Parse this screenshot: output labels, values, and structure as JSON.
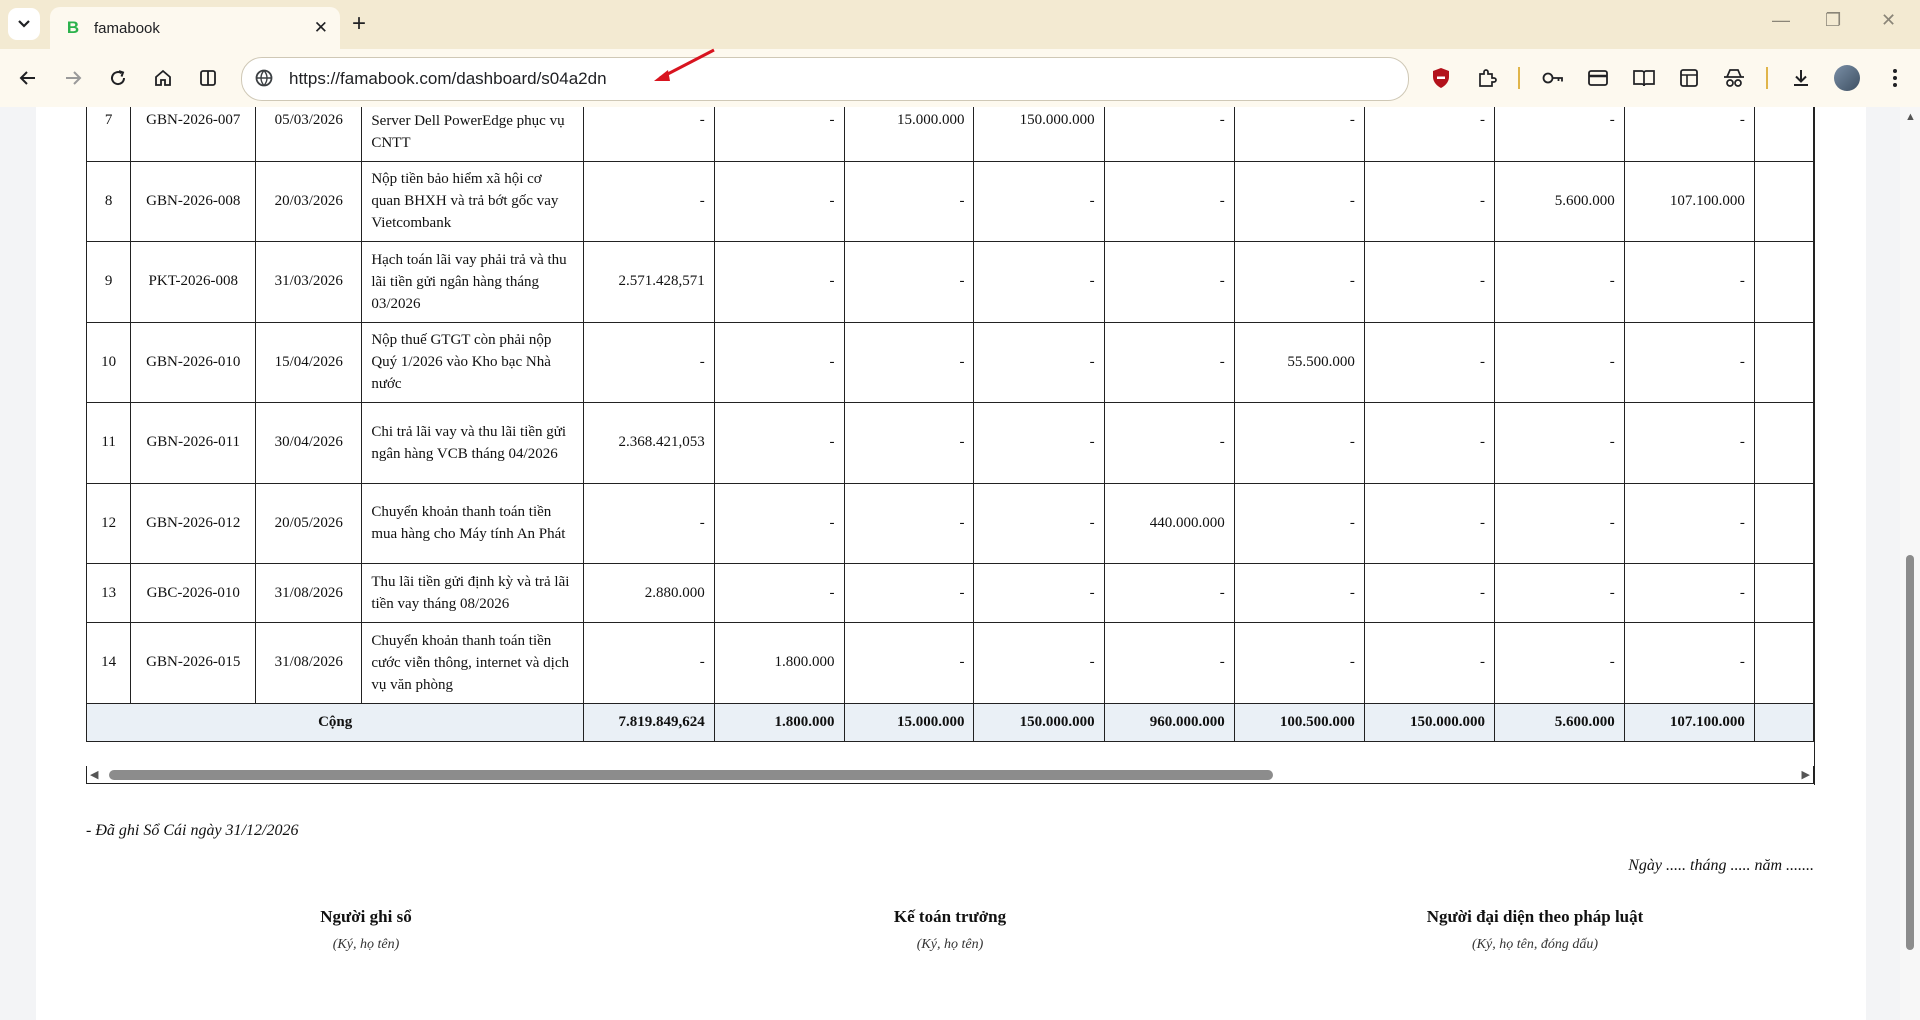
{
  "browser": {
    "tab_title": "famabook",
    "favicon_letter": "B",
    "url": "https://famabook.com/dashboard/s04a2dn",
    "accent": "#f3ead2"
  },
  "table": {
    "rows": [
      {
        "stt": "7",
        "no": "GBN-2026-007",
        "date": "05/03/2026",
        "desc": "Mua sắm bổ sung máy chủ Server Dell PowerEdge phục vụ CNTT",
        "cols": [
          "-",
          "-",
          "15.000.000",
          "150.000.000",
          "-",
          "-",
          "-",
          "-",
          "-"
        ]
      },
      {
        "stt": "8",
        "no": "GBN-2026-008",
        "date": "20/03/2026",
        "desc": "Nộp tiền bảo hiểm xã hội cơ quan BHXH và trả bớt gốc vay Vietcombank",
        "cols": [
          "-",
          "-",
          "-",
          "-",
          "-",
          "-",
          "-",
          "5.600.000",
          "107.100.000"
        ]
      },
      {
        "stt": "9",
        "no": "PKT-2026-008",
        "date": "31/03/2026",
        "desc": "Hạch toán lãi vay phải trả và thu lãi tiền gửi ngân hàng tháng 03/2026",
        "cols": [
          "2.571.428,571",
          "-",
          "-",
          "-",
          "-",
          "-",
          "-",
          "-",
          "-"
        ]
      },
      {
        "stt": "10",
        "no": "GBN-2026-010",
        "date": "15/04/2026",
        "desc": "Nộp thuế GTGT còn phải nộp Quý 1/2026 vào Kho bạc Nhà nước",
        "cols": [
          "-",
          "-",
          "-",
          "-",
          "-",
          "55.500.000",
          "-",
          "-",
          "-"
        ]
      },
      {
        "stt": "11",
        "no": "GBN-2026-011",
        "date": "30/04/2026",
        "desc": "Chi trả lãi vay và thu lãi tiền gửi ngân hàng VCB tháng 04/2026",
        "cols": [
          "2.368.421,053",
          "-",
          "-",
          "-",
          "-",
          "-",
          "-",
          "-",
          "-"
        ]
      },
      {
        "stt": "12",
        "no": "GBN-2026-012",
        "date": "20/05/2026",
        "desc": "Chuyển khoản thanh toán tiền mua hàng cho Máy tính An Phát",
        "cols": [
          "-",
          "-",
          "-",
          "-",
          "440.000.000",
          "-",
          "-",
          "-",
          "-"
        ]
      },
      {
        "stt": "13",
        "no": "GBC-2026-010",
        "date": "31/08/2026",
        "desc": "Thu lãi tiền gửi định kỳ và trả lãi tiền vay tháng 08/2026",
        "cols": [
          "2.880.000",
          "-",
          "-",
          "-",
          "-",
          "-",
          "-",
          "-",
          "-"
        ]
      },
      {
        "stt": "14",
        "no": "GBN-2026-015",
        "date": "31/08/2026",
        "desc": "Chuyển khoản thanh toán tiền cước viễn thông, internet và dịch vụ văn phòng",
        "cols": [
          "-",
          "1.800.000",
          "-",
          "-",
          "-",
          "-",
          "-",
          "-",
          "-"
        ]
      }
    ],
    "total_label": "Cộng",
    "totals": [
      "7.819.849,624",
      "1.800.000",
      "15.000.000",
      "150.000.000",
      "960.000.000",
      "100.500.000",
      "150.000.000",
      "5.600.000",
      "107.100.000"
    ]
  },
  "footer": {
    "note": "- Đã ghi Sổ Cái ngày 31/12/2026",
    "date_line": "Ngày ..... tháng ..... năm .......",
    "signatures": [
      {
        "role": "Người ghi sổ",
        "hint": "(Ký, họ tên)"
      },
      {
        "role": "Kế toán trưởng",
        "hint": "(Ký, họ tên)"
      },
      {
        "role": "Người đại diện theo pháp luật",
        "hint": "(Ký, họ tên, đóng dấu)"
      }
    ]
  },
  "icons": {
    "tab_search": "chevron-down-icon",
    "back": "back-arrow-icon",
    "forward": "forward-arrow-icon",
    "reload": "reload-icon",
    "home": "home-icon",
    "split": "split-view-icon",
    "site_info": "site-info-icon",
    "shield": "shield-extension-icon",
    "puzzle": "extensions-icon",
    "key": "password-key-icon",
    "card": "payment-card-icon",
    "reader": "reading-mode-icon",
    "table": "table-extension-icon",
    "spy": "incognito-extension-icon",
    "download": "download-icon",
    "menu": "kebab-menu-icon"
  }
}
